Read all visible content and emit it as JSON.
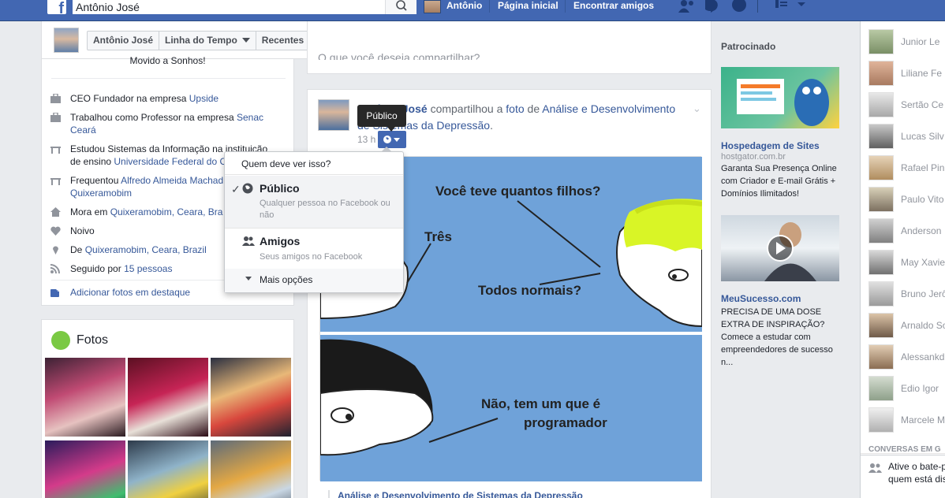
{
  "topbar": {
    "search_value": "Antônio José",
    "user_name": "Antônio",
    "home": "Página inicial",
    "find_friends": "Encontrar amigos"
  },
  "profile": {
    "crumbs": [
      "Antônio José",
      "Linha do Tempo",
      "Recentes"
    ]
  },
  "about": {
    "top_text": "Movido a Sonhos!",
    "rows": [
      {
        "icon": "briefcase-icon",
        "text": "CEO Fundador na empresa ",
        "link": "Upside"
      },
      {
        "icon": "briefcase-icon",
        "text": "Trabalhou como Professor na empresa ",
        "link": "Senac Ceará"
      },
      {
        "icon": "graduation-cap-icon",
        "text": "Estudou Sistemas da Informação na instituição de ensino ",
        "link": "Universidade Federal do C"
      },
      {
        "icon": "graduation-cap-icon",
        "text": "Frequentou ",
        "link": "Alfredo Almeida Machad Quixeramobim"
      },
      {
        "icon": "home-icon",
        "text": "Mora em ",
        "link": "Quixeramobim, Ceara, Bra"
      },
      {
        "icon": "heart-icon",
        "text": "Noivo",
        "link": ""
      },
      {
        "icon": "location-pin-icon",
        "text": "De ",
        "link": "Quixeramobim, Ceara, Brazil"
      },
      {
        "icon": "rss-icon",
        "text": "Seguido por ",
        "link": "15 pessoas"
      }
    ],
    "add_photos": "Adicionar fotos em destaque"
  },
  "photos": {
    "title": "Fotos"
  },
  "composer": {
    "placeholder": "O que você deseja compartilhar?"
  },
  "post": {
    "author": "Antônio José",
    "shared": "compartilhou a",
    "object": "foto",
    "of": "de",
    "page": "Análise e Desenvolvimento de Sistemas da Depressão",
    "time": "13 h",
    "image_texts": {
      "q1": "Você teve quantos filhos?",
      "a1": "Três",
      "q2": "Todos normais?",
      "a2_line1": "Não, tem um que é",
      "a2_line2": "programador"
    },
    "link_title": "Análise e Desenvolvimento de Sistemas da Depressão"
  },
  "privacy": {
    "tooltip": "Público",
    "header": "Quem deve ver isso?",
    "options": [
      {
        "title": "Público",
        "sub": "Qualquer pessoa no Facebook ou não",
        "selected": true
      },
      {
        "title": "Amigos",
        "sub": "Seus amigos no Facebook",
        "selected": false
      }
    ],
    "more": "Mais opções"
  },
  "sponsored": {
    "label": "Patrocinado",
    "ads": [
      {
        "title": "Hospedagem de Sites",
        "domain": "hostgator.com.br",
        "body": "Garanta Sua Presença Online com Criador e E-mail Grátis + Domínios Ilimitados!"
      },
      {
        "title": "MeuSucesso.com",
        "domain": "",
        "body": "PRECISA DE UMA DOSE EXTRA DE INSPIRAÇÃO? Comece a estudar com empreendedores de sucesso n..."
      }
    ]
  },
  "chat": {
    "contacts": [
      "Junior Le",
      "Liliane Fe",
      "Sertão Ce",
      "Lucas Silv",
      "Rafael Pin",
      "Paulo Vito",
      "Anderson",
      "May Xavie",
      "Bruno Jerô",
      "Arnaldo So",
      "Alessankd",
      "Edio Igor",
      "Marcele M"
    ],
    "section": "CONVERSAS EM G",
    "enable": "Ative o bate-p quem está dis"
  },
  "colors": {
    "brand": "#4267b2",
    "link": "#365899",
    "background": "#e9ebee"
  }
}
